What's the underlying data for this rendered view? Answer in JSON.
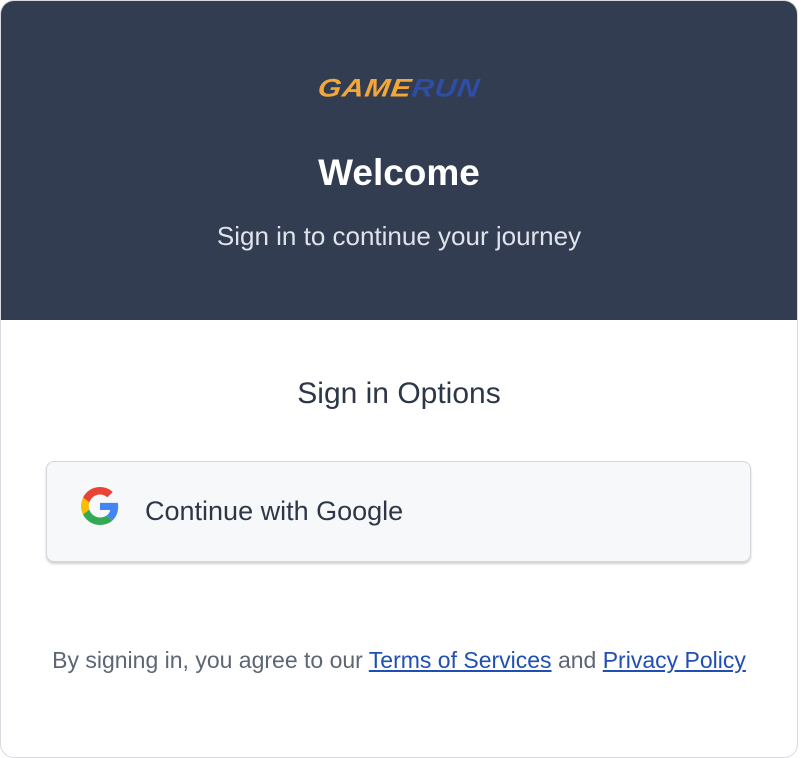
{
  "header": {
    "logo": {
      "part1": "GAME",
      "part2": "RUN"
    },
    "title": "Welcome",
    "subtitle": "Sign in to continue your journey"
  },
  "options": {
    "title": "Sign in Options",
    "google_button_label": "Continue with Google",
    "google_icon": "google-logo-icon"
  },
  "legal": {
    "prefix": "By signing in, you agree to our ",
    "terms_link": "Terms of Services",
    "conjunction": " and ",
    "privacy_link": "Privacy Policy"
  },
  "colors": {
    "header_bg": "#323d51",
    "logo_orange": "#f3a73a",
    "logo_blue": "#2f4da5",
    "link": "#1f4fb2"
  }
}
